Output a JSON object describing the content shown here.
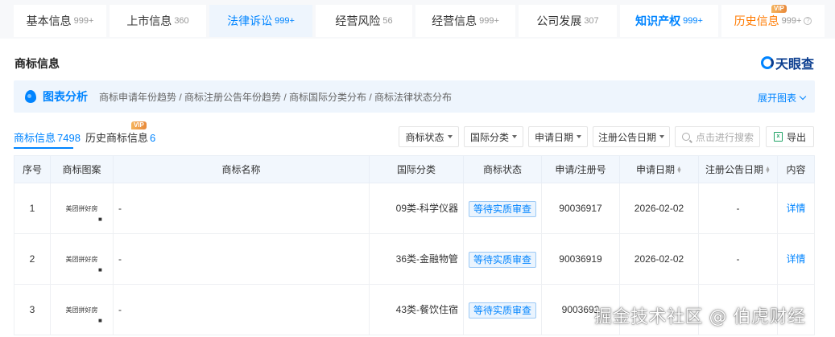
{
  "top_tabs": [
    {
      "label": "基本信息",
      "count": "999+"
    },
    {
      "label": "上市信息",
      "count": "360"
    },
    {
      "label": "法律诉讼",
      "count": "999+"
    },
    {
      "label": "经营风险",
      "count": "56"
    },
    {
      "label": "经营信息",
      "count": "999+"
    },
    {
      "label": "公司发展",
      "count": "307"
    },
    {
      "label": "知识产权",
      "count": "999+"
    },
    {
      "label": "历史信息",
      "count": "999+",
      "badge": "VIP"
    }
  ],
  "section": {
    "title": "商标信息",
    "brand": "天眼查"
  },
  "analysis": {
    "title": "图表分析",
    "links": "商标申请年份趋势 / 商标注册公告年份趋势 / 商标国际分类分布 / 商标法律状态分布",
    "expand": "展开图表"
  },
  "sub_tabs": [
    {
      "label": "商标信息",
      "count": "7498"
    },
    {
      "label": "历史商标信息",
      "count": "6",
      "badge": "VIP"
    }
  ],
  "filters": {
    "status": "商标状态",
    "intl_class": "国际分类",
    "apply_date": "申请日期",
    "reg_date": "注册公告日期",
    "search_placeholder": "点击进行搜索",
    "export": "导出"
  },
  "table": {
    "headers": [
      "序号",
      "商标图案",
      "商标名称",
      "国际分类",
      "商标状态",
      "申请/注册号",
      "申请日期",
      "注册公告日期",
      "内容"
    ],
    "rows": [
      {
        "no": "1",
        "logo": "美团拼好房",
        "logo_mark": "■",
        "name": "-",
        "class": "09类-科学仪器",
        "status": "等待实质审查",
        "reg_no": "90036917",
        "apply_date": "2026-02-02",
        "reg_date": "-",
        "detail": "详情"
      },
      {
        "no": "2",
        "logo": "美团拼好房",
        "logo_mark": "■",
        "name": "-",
        "class": "36类-金融物管",
        "status": "等待实质审查",
        "reg_no": "90036919",
        "apply_date": "2026-02-02",
        "reg_date": "-",
        "detail": "详情"
      },
      {
        "no": "3",
        "logo": "美团拼好房",
        "logo_mark": "■",
        "name": "-",
        "class": "43类-餐饮住宿",
        "status": "等待实质审查",
        "reg_no": "9003692",
        "apply_date": "",
        "reg_date": "",
        "detail": ""
      }
    ]
  },
  "watermark": "掘金技术社区 @ 伯虎财经",
  "colors": {
    "accent": "#0084ff",
    "vip": "#ff7a00",
    "brand": "#0a3d8f"
  }
}
